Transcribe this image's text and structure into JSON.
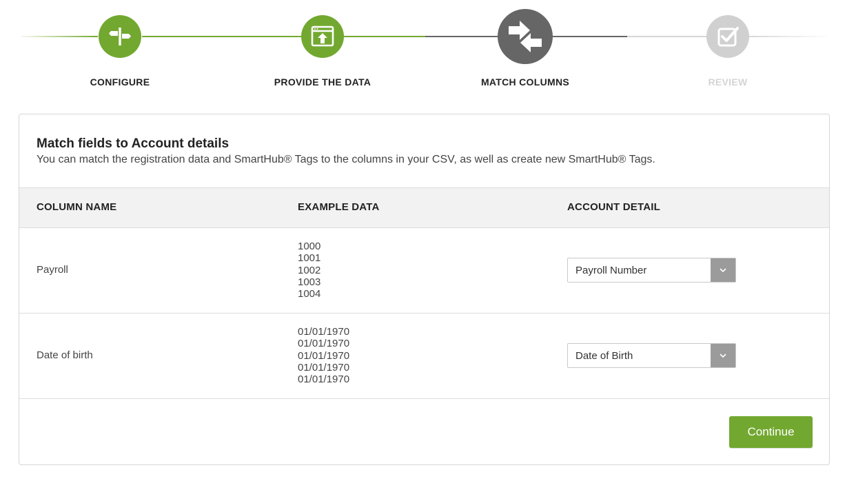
{
  "colors": {
    "complete": "#72a830",
    "active": "#666666",
    "inactive": "#d0d0d0",
    "inactive_label": "#d4d4d4",
    "button": "#72a830"
  },
  "steps": [
    {
      "label": "CONFIGURE",
      "icon": "signpost-icon",
      "state": "complete"
    },
    {
      "label": "PROVIDE THE DATA",
      "icon": "upload-window-icon",
      "state": "complete"
    },
    {
      "label": "MATCH COLUMNS",
      "icon": "swap-arrows-icon",
      "state": "active"
    },
    {
      "label": "REVIEW",
      "icon": "checkbox-check-icon",
      "state": "inactive"
    }
  ],
  "card": {
    "title": "Match fields to Account details",
    "subtitle": "You can match the registration data and SmartHub® Tags to the columns in your CSV, as well as create new SmartHub® Tags."
  },
  "table": {
    "headers": [
      "COLUMN NAME",
      "EXAMPLE DATA",
      "ACCOUNT DETAIL"
    ],
    "rows": [
      {
        "name": "Payroll",
        "examples": [
          "1000",
          "1001",
          "1002",
          "1003",
          "1004"
        ],
        "selected": "Payroll Number"
      },
      {
        "name": "Date of birth",
        "examples": [
          "01/01/1970",
          "01/01/1970",
          "01/01/1970",
          "01/01/1970",
          "01/01/1970"
        ],
        "selected": "Date of Birth"
      }
    ]
  },
  "actions": {
    "continue_label": "Continue"
  }
}
